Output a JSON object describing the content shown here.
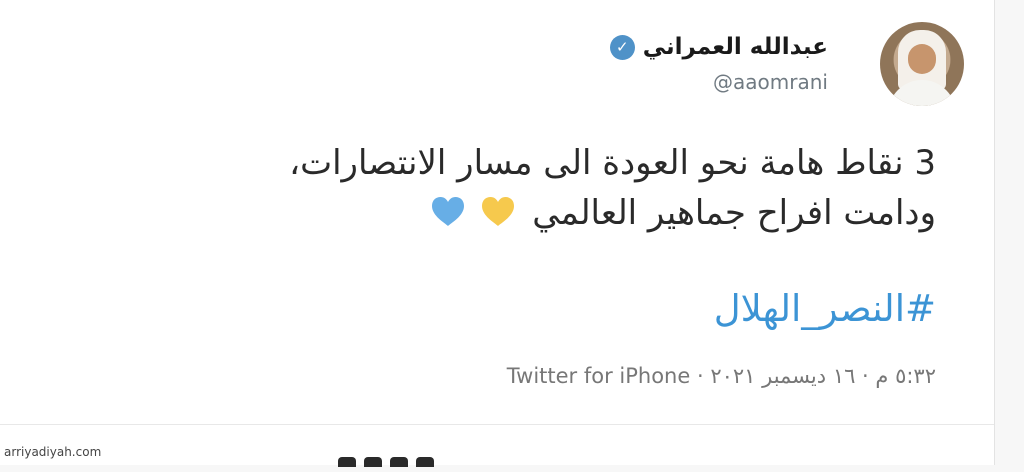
{
  "tweet": {
    "author_name": "عبدالله العمراني",
    "handle": "@aaomrani",
    "text_line1": "3 نقاط هامة نحو العودة الى مسار الانتصارات،",
    "text_line2": "ودامت افراح جماهير العالمي",
    "hashtag": "#النصر_الهلال",
    "timestamp": "٥:٣٢ م · ١٦ ديسمبر ٢٠٢١ · Twitter for iPhone",
    "heart_icons": [
      "yellow-heart-icon",
      "blue-heart-icon"
    ]
  },
  "watermark": "arriyadiyah.com",
  "colors": {
    "verified_badge": "#4f92c8",
    "hashtag": "#3c94d5",
    "yellow_heart": "#f6c94d",
    "blue_heart": "#67aee6"
  }
}
